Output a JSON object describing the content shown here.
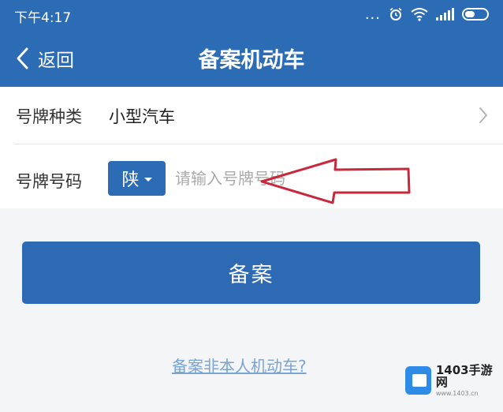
{
  "status_bar": {
    "time": "下午4:17",
    "dots": "...",
    "icons": [
      "alarm-icon",
      "wifi-icon",
      "signal-icon",
      "battery-icon"
    ]
  },
  "nav": {
    "back_label": "返回",
    "title": "备案机动车"
  },
  "form": {
    "plate_type": {
      "label": "号牌种类",
      "value": "小型汽车"
    },
    "plate_number": {
      "label": "号牌号码",
      "province": "陕",
      "placeholder": "请输入号牌号码",
      "value": ""
    }
  },
  "submit_label": "备案",
  "other_link": "备案非本人机动车?",
  "watermark": {
    "title": "1403手游网",
    "subtitle": "www.1403.cn"
  },
  "colors": {
    "header": "#2b6cb4",
    "button": "#2e69b4",
    "link": "#7aa4d4",
    "annotation_arrow": "#c8283c"
  }
}
